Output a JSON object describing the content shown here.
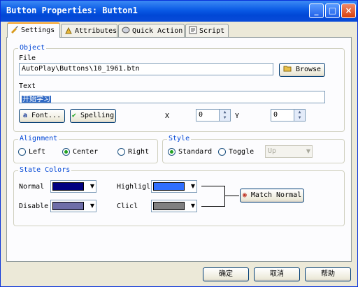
{
  "window": {
    "title": "Button Properties: Button1",
    "minimize": "_",
    "maximize": "□",
    "close": "×"
  },
  "tabs": [
    {
      "label": "Settings",
      "icon": "settings-icon"
    },
    {
      "label": "Attributes",
      "icon": "attributes-icon"
    },
    {
      "label": "Quick Action",
      "icon": "quick-action-icon"
    },
    {
      "label": "Script",
      "icon": "script-icon"
    }
  ],
  "object": {
    "group_label": "Object",
    "file_label": "File",
    "file_value": "AutoPlay\\Buttons\\10_1961.btn",
    "browse_label": "Browse",
    "text_label": "Text",
    "text_value": "开始学习",
    "font_label": "Font...",
    "spelling_label": "Spelling",
    "x_label": "X",
    "x_value": "0",
    "y_label": "Y",
    "y_value": "0"
  },
  "alignment": {
    "group_label": "Alignment",
    "left": "Left",
    "center": "Center",
    "right": "Right",
    "selected": "Center"
  },
  "style": {
    "group_label": "Style",
    "standard": "Standard",
    "toggle": "Toggle",
    "toggle_state": "Up",
    "selected": "Standard"
  },
  "state_colors": {
    "group_label": "State Colors",
    "normal_label": "Normal",
    "normal_color": "#000080",
    "highlight_label": "Highligl",
    "highlight_color": "#2f6fff",
    "disabled_label": "Disable",
    "disabled_color": "#6e6ea8",
    "click_label": "Clicl",
    "click_color": "#808080",
    "match_normal": "Match Normal"
  },
  "buttons": {
    "ok": "确定",
    "cancel": "取消",
    "help": "帮助"
  }
}
